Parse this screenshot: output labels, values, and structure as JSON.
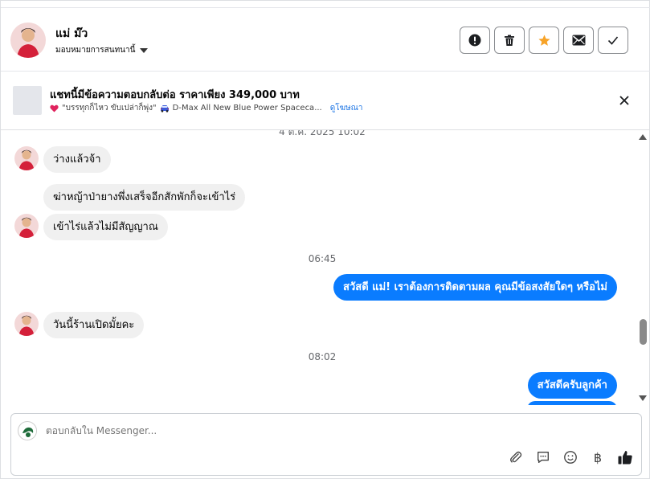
{
  "header": {
    "contact_name": "แม่ ม๊ว",
    "assign_label": "มอบหมายการสนทนานี้",
    "actions": [
      "exclamation-icon",
      "trash-icon",
      "star-icon",
      "envelope-icon",
      "check-icon"
    ]
  },
  "ad": {
    "title": "แชทนี้มีข้อความตอบกลับต่อ ราคาเพียง 349,000 บาท",
    "subtitle": "\"บรรทุกก็ไหว ขับเปล่าก็พุ่ง\"",
    "product": "D-Max All New Blue Power Spaceca...",
    "link": "ดูโฆษณา"
  },
  "messages": {
    "top_timestamp": "4 ต.ค. 2025 10:02",
    "m1": "ว่างแล้วจ้า",
    "m2": "ฆ่าหญ้าป่ายางพึ่งเสร็จอีกสักพักก็จะเข้าไร่",
    "m3": "เข้าไร่แล้วไม่มีสัญญาณ",
    "ts1": "06:45",
    "m4": "สวัสดี แม่! เราต้องการติดตามผล คุณมีข้อสงสัยใดๆ หรือไม่",
    "m5": "วันนี้ร้านเปิดมั้ยคะ",
    "ts2": "08:02",
    "m6": "สวัสดีครับลูกค้า"
  },
  "composer": {
    "placeholder": "ตอบกลับใน Messenger...",
    "tools": [
      "paperclip-icon",
      "chat-bubble-icon",
      "smiley-icon",
      "baht-icon",
      "thumbs-up-icon"
    ],
    "baht_symbol": "฿"
  },
  "colors": {
    "accent": "#0a7cff",
    "star": "#f7a328",
    "bubble_in": "#f0f0f0"
  }
}
